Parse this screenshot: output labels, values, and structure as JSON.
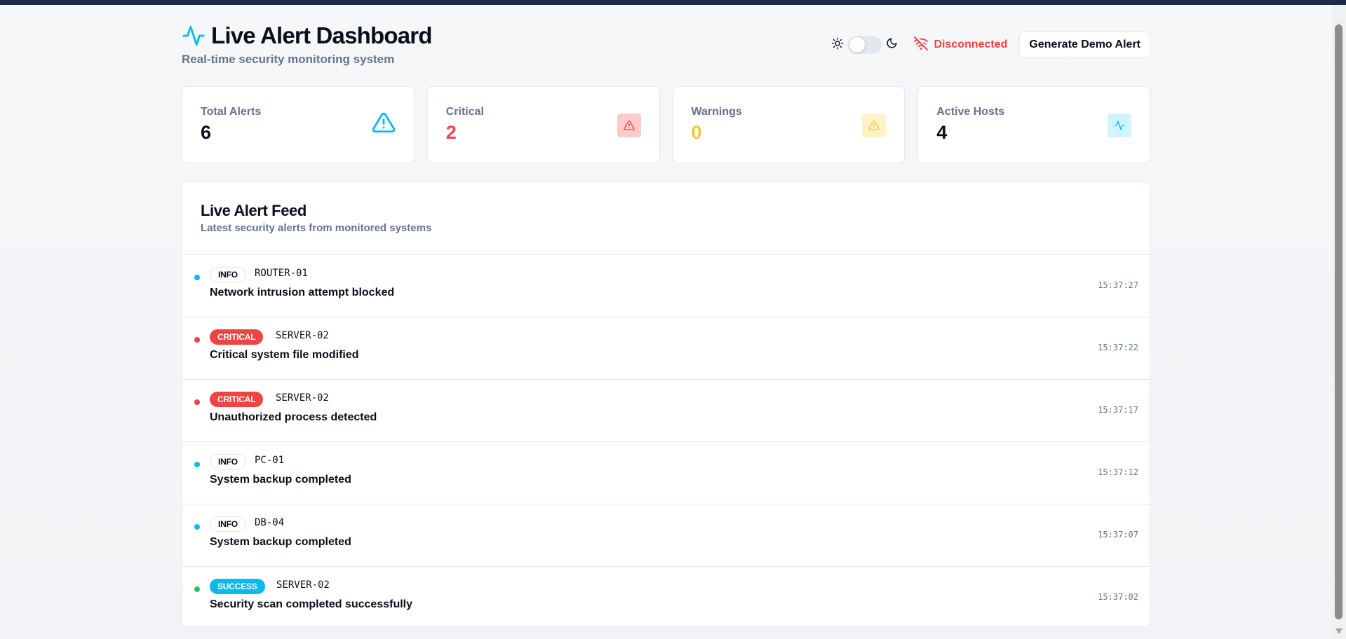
{
  "header": {
    "title": "Live Alert Dashboard",
    "subtitle": "Real-time security monitoring system",
    "title_icon": "activity-pulse-icon"
  },
  "controls": {
    "theme_light_icon": "sun-icon",
    "theme_dark_icon": "moon-icon",
    "theme_toggle_on": false,
    "connection_icon": "wifi-off-icon",
    "connection_status": "Disconnected",
    "demo_button_label": "Generate Demo Alert"
  },
  "stats": [
    {
      "title": "Total Alerts",
      "value": "6",
      "icon": "alert-triangle-icon",
      "color": "#0a0f1c",
      "icon_color": "#0ab9ef"
    },
    {
      "title": "Critical",
      "value": "2",
      "icon": "alert-triangle-icon",
      "color": "#ef4444",
      "icon_color": "#ef4444"
    },
    {
      "title": "Warnings",
      "value": "0",
      "icon": "alert-triangle-icon",
      "color": "#f6c53d",
      "icon_color": "#f6c53d"
    },
    {
      "title": "Active Hosts",
      "value": "4",
      "icon": "activity-pulse-icon",
      "color": "#0a0f1c",
      "icon_color": "#0ab9ef"
    }
  ],
  "feed": {
    "title": "Live Alert Feed",
    "subtitle": "Latest security alerts from monitored systems",
    "alerts": [
      {
        "severity": "INFO",
        "host": "ROUTER-01",
        "message": "Network intrusion attempt blocked",
        "time": "15:37:27",
        "dot_color": "#0ab9ef"
      },
      {
        "severity": "CRITICAL",
        "host": "SERVER-02",
        "message": "Critical system file modified",
        "time": "15:37:22",
        "dot_color": "#ef4444"
      },
      {
        "severity": "CRITICAL",
        "host": "SERVER-02",
        "message": "Unauthorized process detected",
        "time": "15:37:17",
        "dot_color": "#ef4444"
      },
      {
        "severity": "INFO",
        "host": "PC-01",
        "message": "System backup completed",
        "time": "15:37:12",
        "dot_color": "#0ab9ef"
      },
      {
        "severity": "INFO",
        "host": "DB-04",
        "message": "System backup completed",
        "time": "15:37:07",
        "dot_color": "#0ab9ef"
      },
      {
        "severity": "SUCCESS",
        "host": "SERVER-02",
        "message": "Security scan completed successfully",
        "time": "15:37:02",
        "dot_color": "#22c55e"
      }
    ]
  }
}
